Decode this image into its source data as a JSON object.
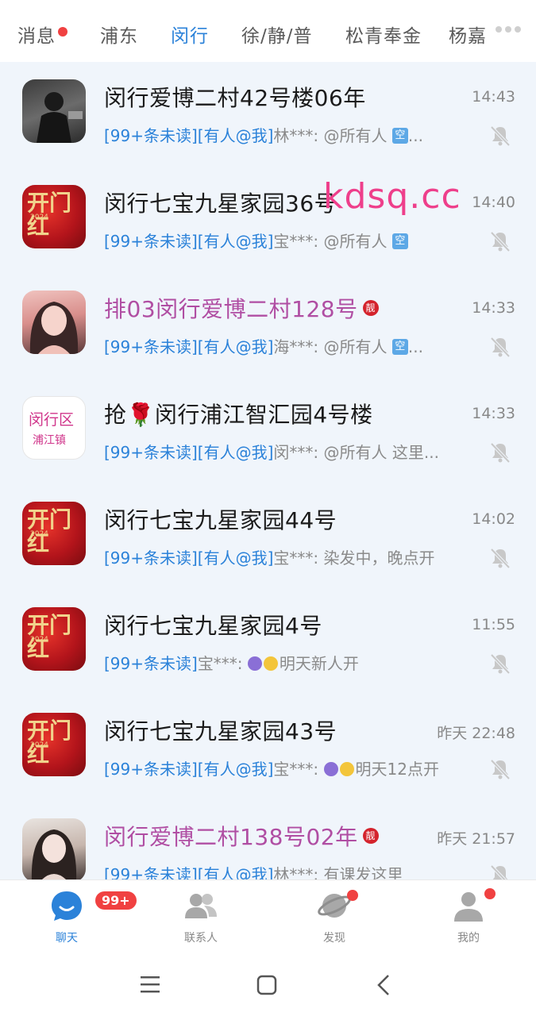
{
  "tabs": [
    {
      "label": "消息",
      "active": false,
      "dot": true
    },
    {
      "label": "浦东",
      "active": false
    },
    {
      "label": "闵行",
      "active": true
    },
    {
      "label": "徐/静/普",
      "active": false
    },
    {
      "label": "松青奉金",
      "active": false
    },
    {
      "label": "杨嘉",
      "active": false
    }
  ],
  "chats": [
    {
      "title": "闵行爱博二村42号楼06年",
      "time": "14:43",
      "tags": "[99+条未读][有人@我]",
      "sender": "林***:",
      "text": "@所有人 ",
      "kbox": "空",
      "ellipsis": "...",
      "avatar": "photo-dark",
      "pink": false
    },
    {
      "title": "闵行七宝九星家园36号",
      "time": "14:40",
      "tags": "[99+条未读][有人@我]",
      "sender": "宝***:",
      "text": "@所有人 ",
      "kbox": "空",
      "ellipsis": "",
      "avatar": "red",
      "pink": false
    },
    {
      "title": "排03闵行爱博二村128号",
      "time": "14:33",
      "tags": "[99+条未读][有人@我]",
      "sender": "海***:",
      "text": "@所有人 ",
      "kbox": "空",
      "ellipsis": "...",
      "avatar": "girl",
      "pink": true,
      "liang": "靓"
    },
    {
      "title": "抢🌹闵行浦江智汇园4号楼",
      "time": "14:33",
      "tags": "[99+条未读][有人@我]",
      "sender": "闵***:",
      "text": "@所有人 这里...",
      "avatar": "text",
      "pink": false
    },
    {
      "title": "闵行七宝九星家园44号",
      "time": "14:02",
      "tags": "[99+条未读][有人@我]",
      "sender": "宝***:",
      "text": "染发中，晚点开",
      "avatar": "red",
      "pink": false
    },
    {
      "title": "闵行七宝九星家园4号",
      "time": "11:55",
      "tags": "[99+条未读]",
      "sender": "宝***:",
      "text": "明天新人开",
      "moons": true,
      "avatar": "red",
      "pink": false
    },
    {
      "title": "闵行七宝九星家园43号",
      "time": "昨天 22:48",
      "tags": "[99+条未读][有人@我]",
      "sender": "宝***:",
      "text": "明天12点开",
      "moons": true,
      "avatar": "red",
      "pink": false
    },
    {
      "title": "闵行爱博二村138号02年",
      "time": "昨天 21:57",
      "tags": "[99+条未读][有人@我]",
      "sender": "林***:",
      "text": "有课发这里",
      "avatar": "girl2",
      "pink": true,
      "liang": "靓"
    }
  ],
  "avatar_text": {
    "line1": "闵行区",
    "line2": "浦江镇"
  },
  "avatar_red": {
    "glyph": "开门红",
    "year": "2024"
  },
  "watermark": "kdsq.cc",
  "nav": [
    {
      "label": "聊天",
      "active": true,
      "badge": "99+"
    },
    {
      "label": "联系人",
      "active": false
    },
    {
      "label": "发现",
      "active": false,
      "dot": true
    },
    {
      "label": "我的",
      "active": false,
      "dot": true
    }
  ],
  "colors": {
    "accent": "#2b82d9",
    "pink_title": "#b04ea3",
    "badge_red": "#f04141",
    "background": "#f0f5fb"
  }
}
